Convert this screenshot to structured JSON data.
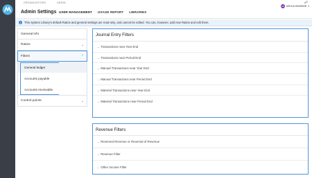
{
  "top_tabs": [
    "ORGANIZATIONS",
    "ADMIN"
  ],
  "header": {
    "title": "Admin Settings",
    "nav": [
      "USER MANAGEMENT",
      "USAGE REPORT",
      "LIBRARIES"
    ],
    "user": {
      "initials": "AS",
      "name": "ASHLIA SHANDAR"
    }
  },
  "banner": {
    "text": "This System Library's default Ratios and general settings are read-only, and cannot be edited. You can, however, add new Ratios and edit them."
  },
  "sidebar": {
    "items": [
      {
        "label": "General info"
      },
      {
        "label": "Ratios"
      },
      {
        "label": "Filters"
      },
      {
        "label": "Control points"
      }
    ],
    "filters_children": [
      "General ledger",
      "Accounts payable",
      "Accounts receivable"
    ]
  },
  "journal_panel": {
    "title": "Journal Entry Filters",
    "rows": [
      "Transactions near Year End",
      "Transactions near Period End",
      "Manual Transactions near Year End",
      "Manual Transactions near Period End",
      "Material Transactions near Year End",
      "Material Transactions near Period End"
    ]
  },
  "revenue_panel": {
    "title": "Revenue Filters",
    "rows": [
      "Reversed Revenue or Reversal of Revenue",
      "Revenue Filter",
      "Other Income Filter"
    ]
  },
  "colors": {
    "rail": "#3a3f47",
    "highlight": "#4f93d9",
    "banner_bg": "#eaf2fb",
    "avatar": "#7b3fb2"
  },
  "icons": [
    "logo-icon",
    "info-icon",
    "chevron-down-icon",
    "chevron-up-icon",
    "bell-icon"
  ]
}
